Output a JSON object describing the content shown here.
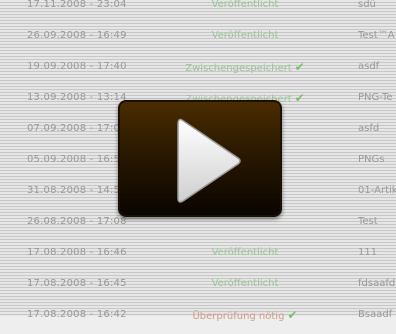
{
  "rows": [
    {
      "date": "17.11.2008 - 23:04",
      "status": "Veröffentlicht",
      "status_color": "#9dc49a",
      "check": false,
      "title": "sdü"
    },
    {
      "date": "26.09.2008 - 16:49",
      "status": "Veröffentlicht",
      "status_color": "#9dc49a",
      "check": false,
      "title": "Test™A"
    },
    {
      "date": "19.09.2008 - 17:40",
      "status": "Zwischengespeichert",
      "status_color": "#9dc49a",
      "check": true,
      "title": "asdf"
    },
    {
      "date": "13.09.2008 - 13:14",
      "status": "Zwischengespeichert",
      "status_color": "#9dc49a",
      "check": true,
      "title": "PNG-Te"
    },
    {
      "date": "07.09.2008 - 17:05",
      "status": "",
      "status_color": "#9dc49a",
      "check": false,
      "title": "asfd"
    },
    {
      "date": "05.09.2008 - 16:50",
      "status": "",
      "status_color": "#9dc49a",
      "check": false,
      "title": "PNGs"
    },
    {
      "date": "31.08.2008 - 14:52",
      "status": "",
      "status_color": "#9dc49a",
      "check": false,
      "title": "01-Artik"
    },
    {
      "date": "26.08.2008 - 17:08",
      "status": "",
      "status_color": "#9dc49a",
      "check": false,
      "title": "Test"
    },
    {
      "date": "17.08.2008 - 16:46",
      "status": "Veröffentlicht",
      "status_color": "#9dc49a",
      "check": false,
      "title": "111"
    },
    {
      "date": "17.08.2008 - 16:45",
      "status": "Veröffentlicht",
      "status_color": "#9dc49a",
      "check": false,
      "title": "fdsaafd"
    },
    {
      "date": "17.08.2008 - 16:42",
      "status": "Überprüfung nötig",
      "status_color": "#d49a8a",
      "check": true,
      "title": "Bsaadf"
    }
  ],
  "player": {
    "icon": "play-icon",
    "check_icon": "check-icon"
  }
}
